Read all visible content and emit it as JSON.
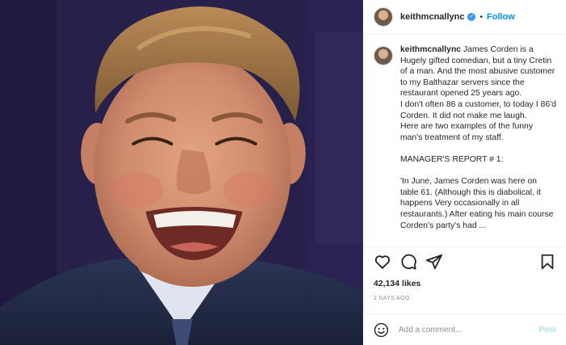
{
  "post": {
    "username": "keithmcnallync",
    "verified_icon": "verified-badge-icon",
    "separator": "•",
    "follow_label": "Follow",
    "caption_username": "keithmcnallync",
    "caption_lines": [
      "James Corden is a Hugely gifted comedian, but a tiny Cretin of a man. And the most abusive customer to my Balthazar servers since the restaurant opened 25 years ago.",
      "I don't often 86 a customer, to today I 86'd Corden. It did not make me laugh.",
      "Here are two examples of the funny man's treatment of my staff.",
      "",
      "MANAGER'S REPORT # 1:",
      "",
      "'In June, James Corden was here on table 61. (Although this is diabolical, it happens Very occasionally in all restaurants.) After eating his main course Corden's party's had ..."
    ],
    "likes": "42,134 likes",
    "time_ago": "2 DAYS AGO",
    "comment_placeholder": "Add a comment...",
    "post_label": "Post",
    "icons": [
      "heart-icon",
      "comment-icon",
      "share-icon",
      "bookmark-icon",
      "emoji-icon"
    ],
    "accent_color": "#0095f6"
  }
}
